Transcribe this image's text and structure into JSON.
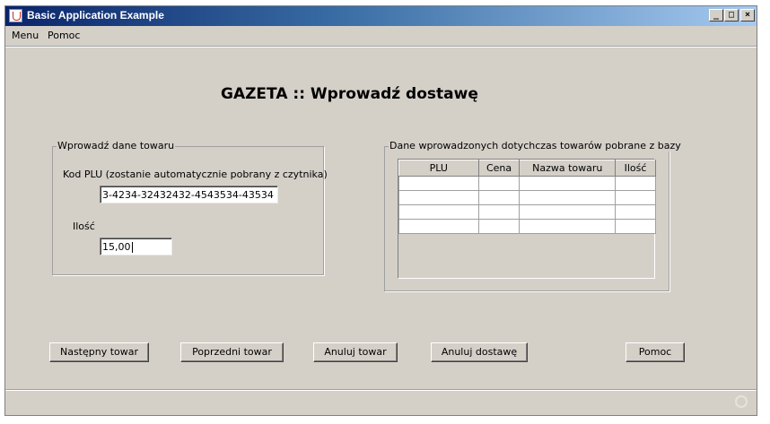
{
  "window": {
    "title": "Basic Application Example",
    "controls": {
      "minimize": "_",
      "maximize": "□",
      "close": "×"
    }
  },
  "menu": {
    "items": [
      "Menu",
      "Pomoc"
    ]
  },
  "heading": "GAZETA :: Wprowadź dostawę",
  "product_group": {
    "title": "Wprowadź dane towaru",
    "plu_label": "Kod PLU (zostanie automatycznie pobrany z czytnika)",
    "plu_value": "3-4234-32432432-4543534-43534",
    "qty_label": "Ilość",
    "qty_value": "15,00"
  },
  "table_group": {
    "title": "Dane wprowadzonych dotychczas towarów pobrane z bazy",
    "columns": [
      "PLU",
      "Cena",
      "Nazwa towaru",
      "Ilość"
    ],
    "rows": [
      [
        "",
        "",
        "",
        ""
      ],
      [
        "",
        "",
        "",
        ""
      ],
      [
        "",
        "",
        "",
        ""
      ],
      [
        "",
        "",
        "",
        ""
      ]
    ]
  },
  "buttons": {
    "next": "Następny towar",
    "prev": "Poprzedni towar",
    "cancel_item": "Anuluj towar",
    "cancel_delivery": "Anuluj dostawę",
    "help": "Pomoc"
  }
}
